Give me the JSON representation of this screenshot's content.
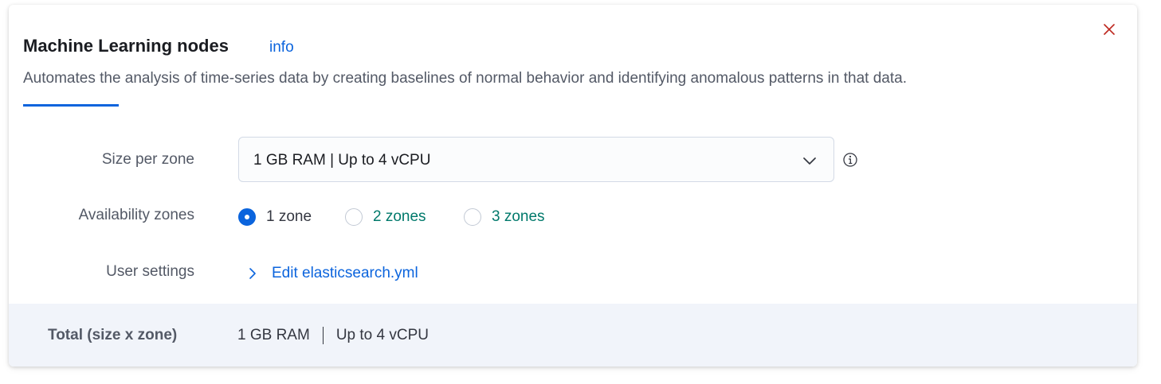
{
  "header": {
    "title": "Machine Learning nodes",
    "info_link": "info",
    "description": "Automates the analysis of time-series data by creating baselines of normal behavior and identifying anomalous patterns in that data."
  },
  "form": {
    "size_per_zone": {
      "label": "Size per zone",
      "selected_value": "1 GB RAM | Up to 4 vCPU"
    },
    "availability_zones": {
      "label": "Availability zones",
      "options": [
        {
          "label": "1 zone",
          "selected": true
        },
        {
          "label": "2 zones",
          "selected": false
        },
        {
          "label": "3 zones",
          "selected": false
        }
      ]
    },
    "user_settings": {
      "label": "User settings",
      "link": "Edit elasticsearch.yml"
    }
  },
  "footer": {
    "label": "Total (size x zone)",
    "ram": "1 GB RAM",
    "cpu": "Up to 4 vCPU"
  },
  "colors": {
    "accent": "#0b64dd",
    "close": "#bd271e",
    "link_teal": "#00796b",
    "footer_bg": "#f1f4fa"
  },
  "icons": {
    "close": "close-icon",
    "chevron": "chevron-down-icon",
    "info": "info-circle-icon",
    "expand": "chevron-right-icon"
  }
}
